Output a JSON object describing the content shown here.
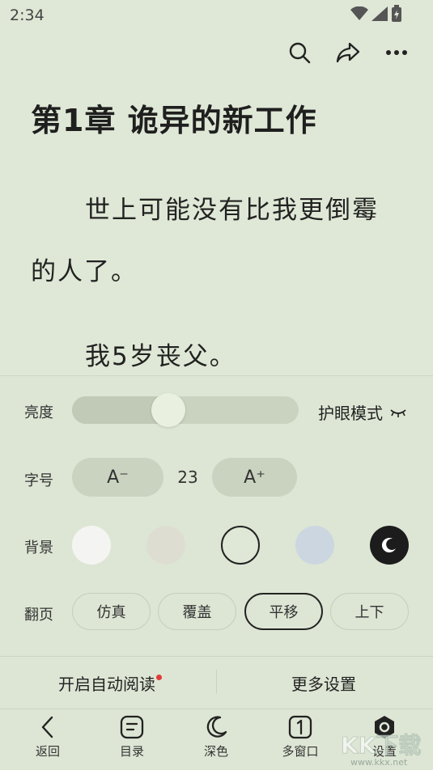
{
  "status": {
    "time": "2:34"
  },
  "chapter": {
    "title": "第1章 诡异的新工作",
    "paragraphs": [
      "世上可能没有比我更倒霉",
      "的人了。",
      "我5岁丧父。"
    ]
  },
  "settings": {
    "brightness": {
      "label": "亮度",
      "value": 0.41,
      "eye_mode": "护眼模式"
    },
    "font_size": {
      "label": "字号",
      "decrease": "A⁻",
      "value": "23",
      "increase": "A⁺"
    },
    "background": {
      "label": "背景",
      "options": [
        "#f4f5f2",
        "#ddded1",
        "#dfe8d6",
        "#ccd6e0",
        "#1c1c1c"
      ],
      "selected": 2
    },
    "page_turn": {
      "label": "翻页",
      "options": [
        "仿真",
        "覆盖",
        "平移",
        "上下"
      ],
      "selected": 2
    }
  },
  "actions": {
    "auto_read": "开启自动阅读",
    "more_settings": "更多设置"
  },
  "nav": [
    {
      "label": "返回",
      "icon": "back-icon"
    },
    {
      "label": "目录",
      "icon": "catalog-icon"
    },
    {
      "label": "深色",
      "icon": "moon-icon"
    },
    {
      "label": "多窗口",
      "icon": "multi-window-icon"
    },
    {
      "label": "设置",
      "icon": "settings-icon"
    }
  ],
  "watermark": "KK下载 www.kkx.net"
}
